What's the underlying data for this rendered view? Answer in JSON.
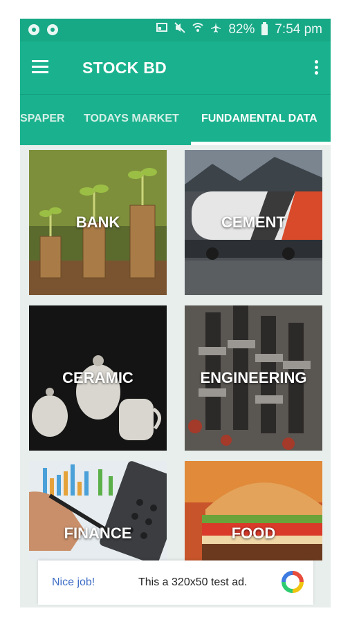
{
  "status_bar": {
    "battery_text": "82%",
    "time": "7:54 pm",
    "icons": [
      "notification-circle-icon",
      "notification-circle-icon",
      "cast-icon",
      "mute-icon",
      "wifi-icon",
      "airplane-icon",
      "battery-icon"
    ]
  },
  "app_bar": {
    "title": "STOCK BD",
    "menu_icon": "hamburger-menu-icon",
    "more_icon": "more-vertical-icon"
  },
  "tabs": [
    {
      "label": "SPAPER",
      "active": false
    },
    {
      "label": "TODAYS MARKET",
      "active": false
    },
    {
      "label": "FUNDAMENTAL DATA",
      "active": true
    }
  ],
  "categories": [
    {
      "label": "BANK",
      "image": "coin-stacks-with-plants"
    },
    {
      "label": "CEMENT",
      "image": "cement-rail-tanker"
    },
    {
      "label": "CERAMIC",
      "image": "ceramic-tea-set"
    },
    {
      "label": "ENGINEERING",
      "image": "engine-parts"
    },
    {
      "label": "FINANCE",
      "image": "calculator-and-charts"
    },
    {
      "label": "FOOD",
      "image": "burger"
    }
  ],
  "ad": {
    "left_text": "Nice job!",
    "message": "This a 320x50 test ad.",
    "logo_icon": "ad-network-logo-icon"
  },
  "colors": {
    "primary": "#1ab28e",
    "status_bar": "#17a886",
    "background": "#e7eeec",
    "ad_link": "#3f6ec6"
  }
}
